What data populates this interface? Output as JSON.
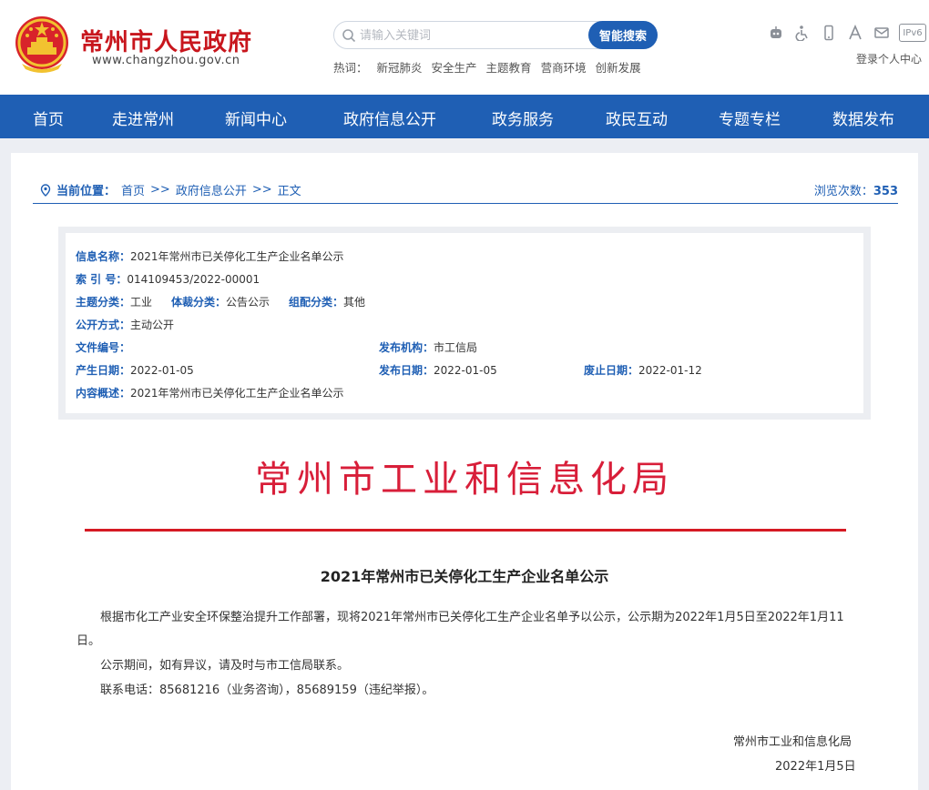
{
  "header": {
    "site_name": "常州市人民政府",
    "site_url": "www.changzhou.gov.cn",
    "search_placeholder": "请输入关键词",
    "search_button": "智能搜索",
    "hot_label": "热词：",
    "hot_words": [
      "新冠肺炎",
      "安全生产",
      "主题教育",
      "营商环境",
      "创新发展"
    ],
    "tools": [
      "robot-icon",
      "accessibility-icon",
      "mobile-icon",
      "font-size-icon",
      "mail-icon"
    ],
    "ipv6": "IPv6",
    "login": "登录个人中心"
  },
  "nav": {
    "items": [
      "首页",
      "走进常州",
      "新闻中心",
      "政府信息公开",
      "政务服务",
      "政民互动",
      "专题专栏",
      "数据发布"
    ]
  },
  "breadcrumb": {
    "label": "当前位置：",
    "items": [
      "首页",
      "政府信息公开",
      "正文"
    ],
    "separator": ">>",
    "views_label": "浏览次数：",
    "views": "353"
  },
  "meta": {
    "name_label": "信息名称：",
    "name": "2021年常州市已关停化工生产企业名单公示",
    "index_label": "索 引 号：",
    "index": "014109453/2022-00001",
    "topic_label": "主题分类：",
    "topic": "工业",
    "genre_label": "体裁分类：",
    "genre": "公告公示",
    "org_cat_label": "组配分类：",
    "org_cat": "其他",
    "open_label": "公开方式：",
    "open": "主动公开",
    "docno_label": "文件编号：",
    "docno": "",
    "issuer_label": "发布机构：",
    "issuer": "市工信局",
    "created_label": "产生日期：",
    "created": "2022-01-05",
    "published_label": "发布日期：",
    "published": "2022-01-05",
    "expire_label": "废止日期：",
    "expire": "2022-01-12",
    "summary_label": "内容概述：",
    "summary": "2021年常州市已关停化工生产企业名单公示"
  },
  "document": {
    "masthead": "常州市工业和信息化局",
    "title": "2021年常州市已关停化工生产企业名单公示",
    "para1": "根据市化工产业安全环保整治提升工作部署，现将2021年常州市已关停化工生产企业名单予以公示，公示期为2022年1月5日至2022年1月11日。",
    "para2": "公示期间，如有异议，请及时与市工信局联系。",
    "para3": "联系电话：85681216（业务咨询），85689159（违纪举报）。",
    "signer": "常州市工业和信息化局",
    "date": "2022年1月5日"
  },
  "colors": {
    "primary_blue": "#1f5fb4",
    "brand_red": "#c8161d",
    "masthead_red": "#d81e39"
  }
}
